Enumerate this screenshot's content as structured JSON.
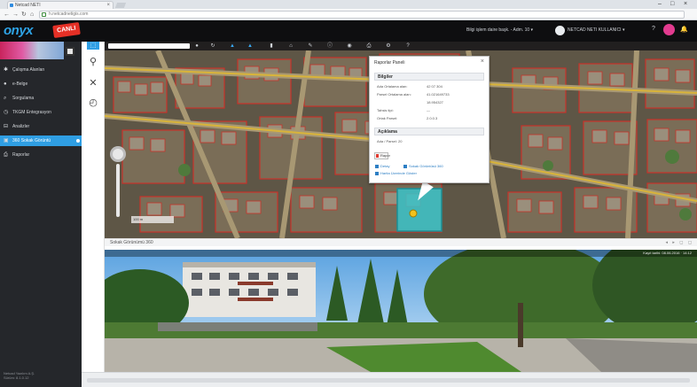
{
  "browser": {
    "tab_title": "Netcad NETI",
    "url": "h.netcadnetigis.com",
    "minimize": "–",
    "maximize": "□",
    "close": "×"
  },
  "app": {
    "logo": "onyx",
    "live_badge": "CANLI",
    "header_info": "Bilgi işlem daire başk. - Adm. 10 ▾",
    "user_name": "NETCAD NETI KULLANICI ▾",
    "help": "?",
    "notifications": "🔔",
    "brand_color": "#2ea3e6",
    "accent_color": "#e53026"
  },
  "sidebar": {
    "items": [
      {
        "icon": "gear-icon",
        "glyph": "✱",
        "label": "Çalışma Alanları"
      },
      {
        "icon": "info-icon",
        "glyph": "●",
        "label": "e-Belge"
      },
      {
        "icon": "search-icon",
        "glyph": "⌕",
        "label": "Sorgulama"
      },
      {
        "icon": "clock-icon",
        "glyph": "◷",
        "label": "TKGM Entegrasyon"
      },
      {
        "icon": "layers-icon",
        "glyph": "⊟",
        "label": "Analizler"
      },
      {
        "icon": "map-icon",
        "glyph": "▣",
        "label": "360 Sokak Görüntü"
      },
      {
        "icon": "print-icon",
        "glyph": "⎙",
        "label": "Raporlar"
      }
    ],
    "active_index": 5,
    "footer_line1": "Netcad Yazılım A.Ş.",
    "footer_line2": "Sürüm: 8.1.0.12"
  },
  "tools": {
    "select": "⬚",
    "zoom": "⚲",
    "clear": "✕",
    "history": "◴"
  },
  "map": {
    "search_placeholder": "",
    "scale_label": "100 m"
  },
  "popup": {
    "title": "Raporlar Paneli",
    "close": "×",
    "section1": "Bilgiler",
    "rows1": [
      {
        "label": "Ada Ortalama alan:",
        "value": "42 07 304"
      },
      {
        "label": "Parsel Ortalama alan:",
        "value": "41.021649733"
      },
      {
        "label": "",
        "value": "18.954327"
      },
      {
        "label": "Tahsis tipi:",
        "value": "—"
      },
      {
        "label": "Ortak Parsel:",
        "value": "2.0.0.3"
      }
    ],
    "section2": "Açıklama",
    "rows2": [
      {
        "label": "Ada / Parsel: 20",
        "value": ""
      }
    ],
    "button": "Rapor",
    "link1": "Detay",
    "link2": "Sokak Görüntüsü 360",
    "link3": "Harita Üzerinde Göster"
  },
  "streetview": {
    "label": "Sokak Görünümü 360",
    "controls": "◂ ▸ ◻ ◻",
    "overlay_text": "Kayıt tarihi: 08.06.2016 · 14:12"
  }
}
